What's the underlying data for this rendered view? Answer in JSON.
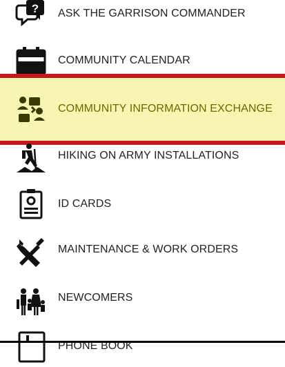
{
  "menu": {
    "items": [
      {
        "label": "ASK THE GARRISON COMMANDER",
        "icon": "chat-question-icon"
      },
      {
        "label": "COMMUNITY CALENDAR",
        "icon": "calendar-icon"
      },
      {
        "label": "COMMUNITY INFORMATION EXCHANGE",
        "icon": "people-exchange-icon",
        "highlighted": true
      },
      {
        "label": "HIKING ON ARMY INSTALLATIONS",
        "icon": "hiker-icon"
      },
      {
        "label": "ID CARDS",
        "icon": "id-card-icon"
      },
      {
        "label": "MAINTENANCE & WORK ORDERS",
        "icon": "wrench-hammer-icon"
      },
      {
        "label": "NEWCOMERS",
        "icon": "family-icon"
      },
      {
        "label": "PHONE BOOK",
        "icon": "phone-book-icon"
      }
    ]
  },
  "colors": {
    "highlight_bg": "#f6f6b2",
    "highlight_border": "#c7161c",
    "highlight_text": "#6a6a00",
    "text": "#222222",
    "icon": "#111111"
  }
}
